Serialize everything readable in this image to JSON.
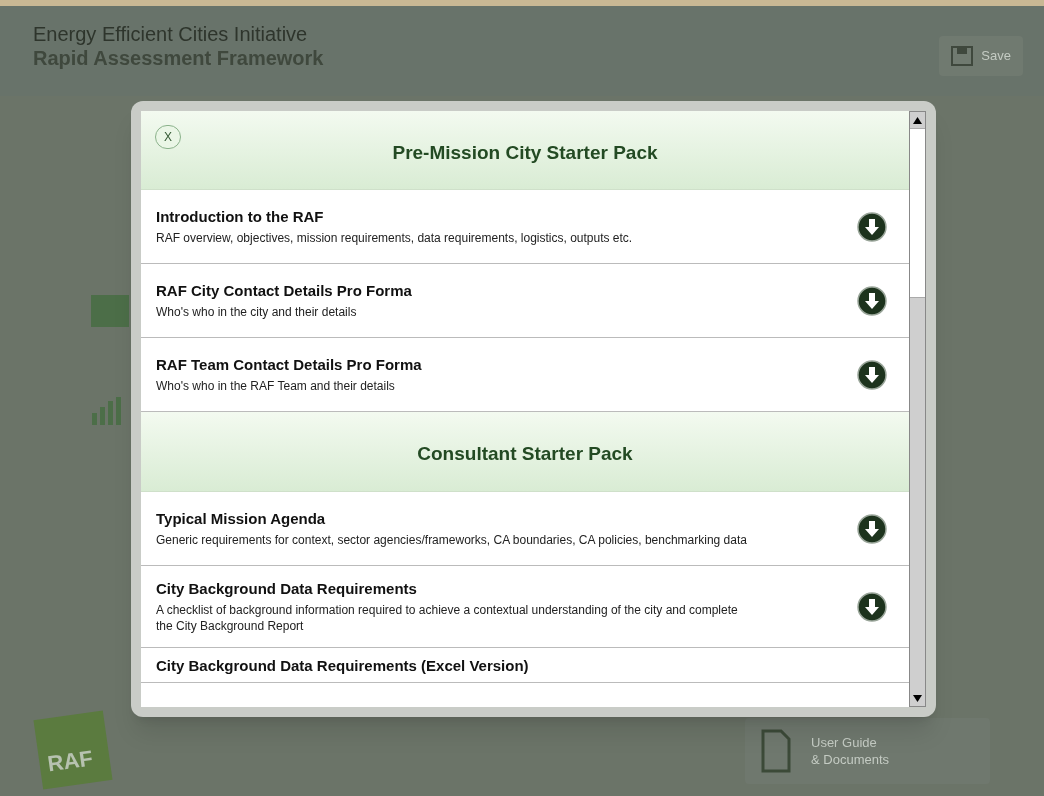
{
  "header": {
    "title": "Energy Efficient Cities Initiative",
    "subtitle": "Rapid Assessment Framework"
  },
  "save_button": {
    "label": "Save"
  },
  "modal": {
    "close": "X",
    "sections": [
      {
        "title": "Pre-Mission City Starter Pack",
        "items": [
          {
            "title": "Introduction to the RAF",
            "description": "RAF overview, objectives, mission requirements, data requirements, logistics, outputs etc."
          },
          {
            "title": "RAF City Contact Details Pro Forma",
            "description": "Who's who in the city and their details"
          },
          {
            "title": "RAF Team Contact Details Pro Forma",
            "description": "Who's who in the RAF Team and their details"
          }
        ]
      },
      {
        "title": "Consultant Starter Pack",
        "items": [
          {
            "title": "Typical Mission Agenda",
            "description": "Generic requirements for context, sector agencies/frameworks, CA boundaries, CA policies, benchmarking data"
          },
          {
            "title": "City Background Data Requirements",
            "description": "A checklist of background information required to achieve a contextual understanding of the city and complete the City Background Report"
          },
          {
            "title": "City Background Data Requirements (Excel Version)"
          }
        ]
      }
    ]
  },
  "user_guide_button": {
    "label_lines": [
      "User Guide",
      "& Documents"
    ]
  },
  "logo": {
    "text": "RAF"
  }
}
